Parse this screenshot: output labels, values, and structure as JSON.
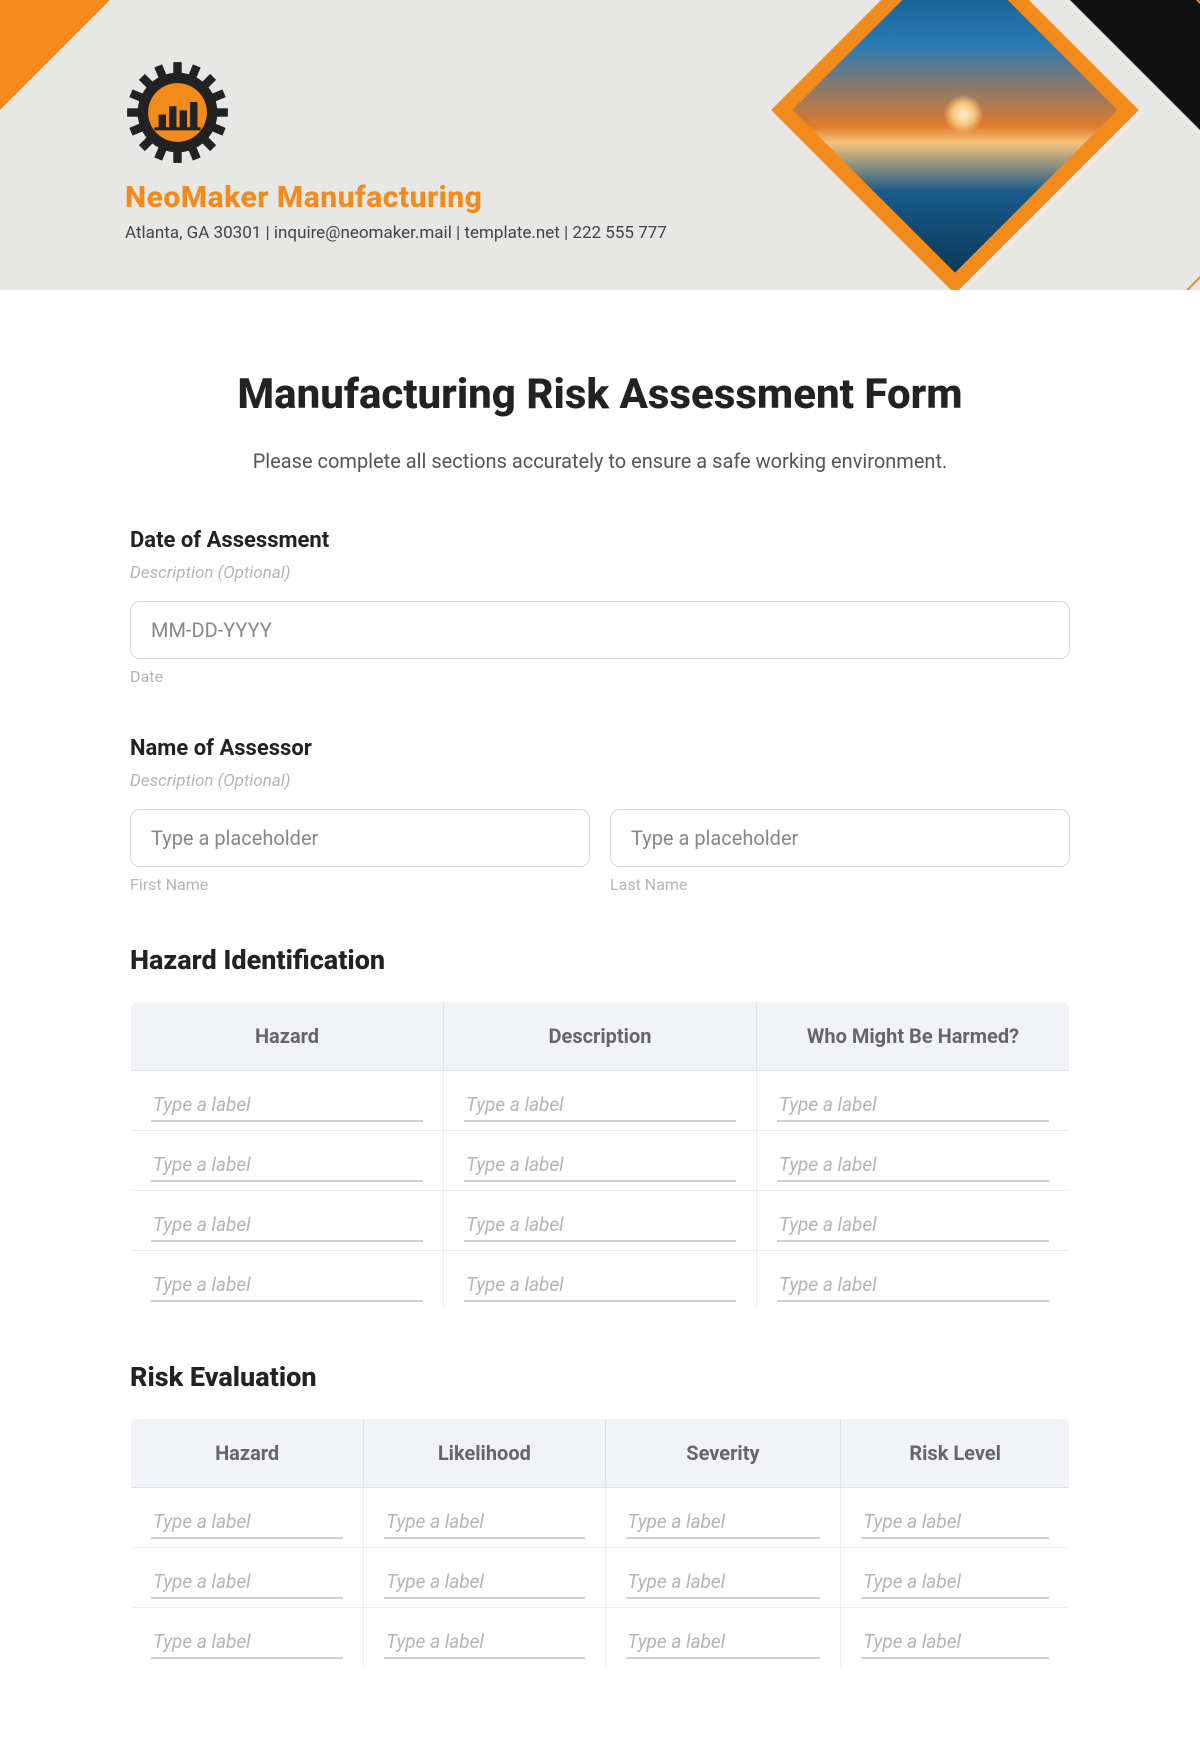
{
  "header": {
    "company_name": "NeoMaker Manufacturing",
    "contact_line": "Atlanta, GA 30301 | inquire@neomaker.mail | template.net | 222 555 777"
  },
  "form": {
    "title": "Manufacturing Risk Assessment Form",
    "intro": "Please complete all sections accurately to ensure a safe working environment."
  },
  "fields": {
    "date": {
      "label": "Date of Assessment",
      "desc": "Description (Optional)",
      "placeholder": "MM-DD-YYYY",
      "sub": "Date"
    },
    "assessor": {
      "label": "Name of Assessor",
      "desc": "Description (Optional)",
      "first_placeholder": "Type a placeholder",
      "last_placeholder": "Type a placeholder",
      "first_sub": "First Name",
      "last_sub": "Last Name"
    }
  },
  "sections": {
    "hazard_id": {
      "title": "Hazard Identification",
      "headers": [
        "Hazard",
        "Description",
        "Who Might Be Harmed?"
      ],
      "rows": 4,
      "cell_placeholder": "Type a label"
    },
    "risk_eval": {
      "title": "Risk Evaluation",
      "headers": [
        "Hazard",
        "Likelihood",
        "Severity",
        "Risk Level"
      ],
      "rows": 3,
      "cell_placeholder": "Type a label"
    }
  }
}
